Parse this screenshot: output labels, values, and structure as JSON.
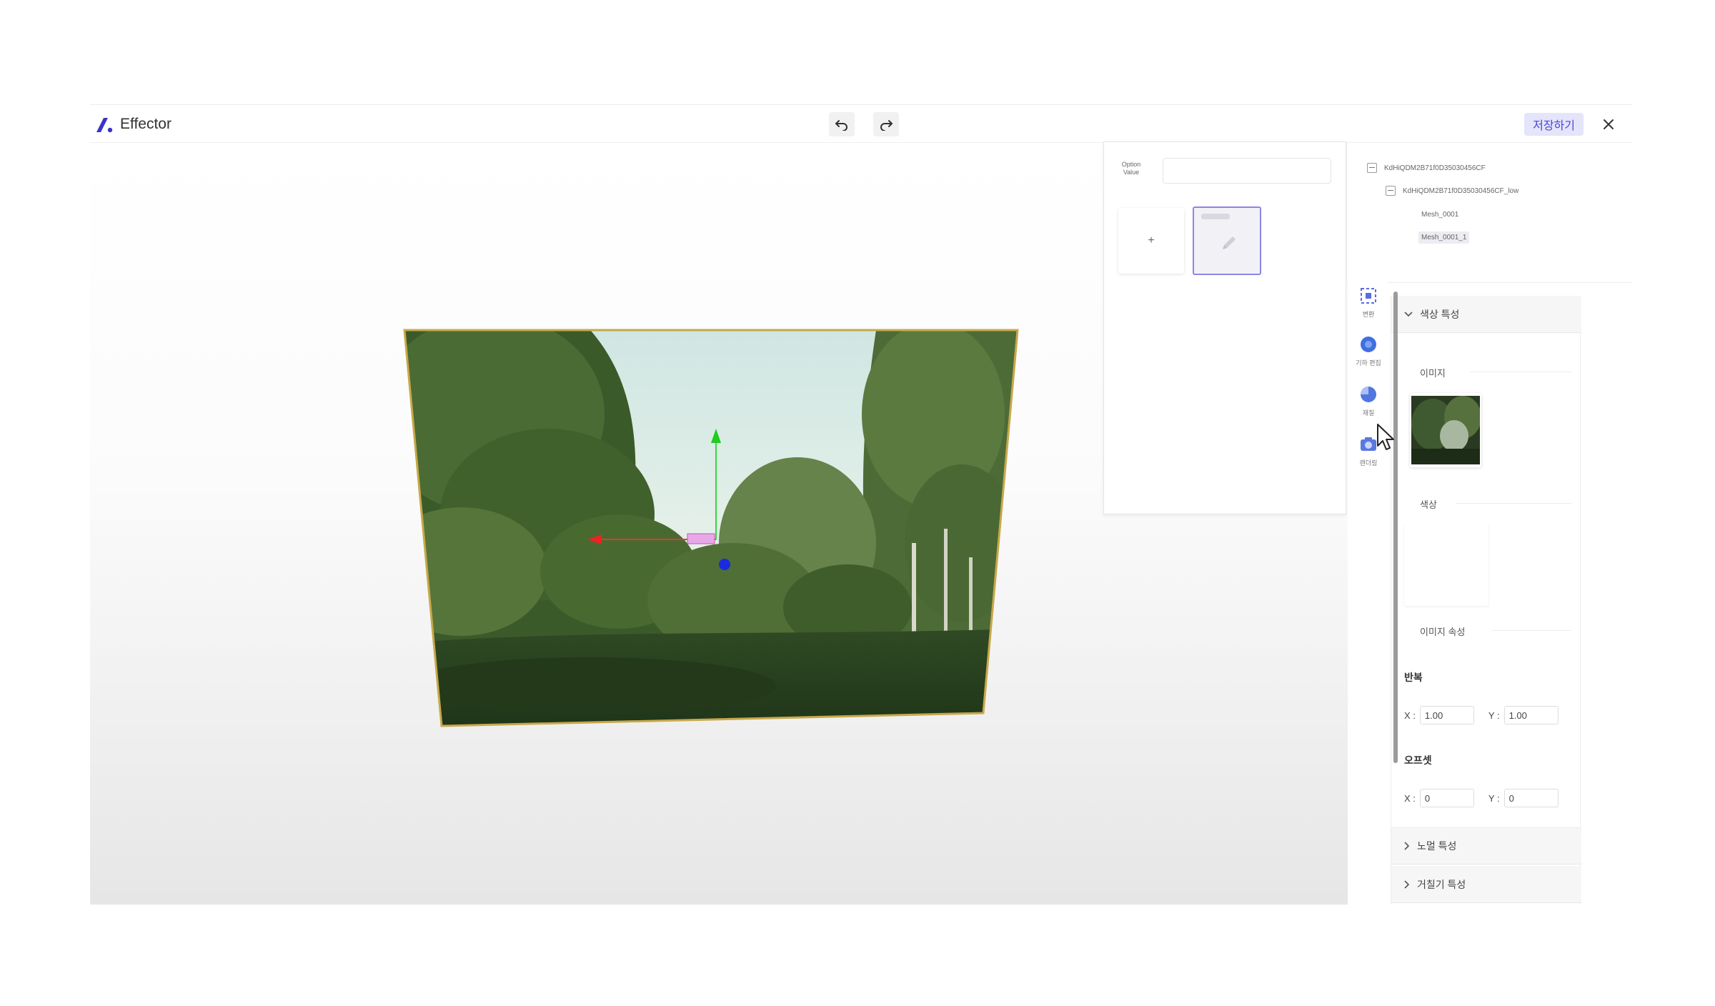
{
  "app": {
    "title": "Effector"
  },
  "toolbar": {
    "undo": "undo-icon",
    "redo": "redo-icon",
    "save_label": "저장하기",
    "close": "close-icon",
    "accent": "#4a47d8"
  },
  "option_panel": {
    "label": "Option Value",
    "input_value": "",
    "add_label": "+"
  },
  "tools": [
    {
      "icon": "transform-icon",
      "label": "변환"
    },
    {
      "icon": "geometry-edit-icon",
      "label": "기하 편집"
    },
    {
      "icon": "material-icon",
      "label": "재질"
    },
    {
      "icon": "camera-icon",
      "label": "렌더링"
    }
  ],
  "scene_tree": {
    "root": "KdHiQDM2B71f0D35030456CF",
    "child": "KdHiQDM2B71f0D35030456CF_low",
    "leaves": [
      "Mesh_0001",
      "Mesh_0001_1"
    ],
    "selected_index": 1
  },
  "properties": {
    "color_section": "색상 특성",
    "image_label": "이미지",
    "color_label": "색상",
    "image_props_label": "이미지 속성",
    "repeat": {
      "label": "반복",
      "x_label": "X :",
      "x": "1.00",
      "y_label": "Y :",
      "y": "1.00"
    },
    "offset": {
      "label": "오프셋",
      "x_label": "X :",
      "x": "0",
      "y_label": "Y :",
      "y": "0"
    },
    "normal_section": "노멀 특성",
    "roughness_section": "거칠기 특성"
  }
}
